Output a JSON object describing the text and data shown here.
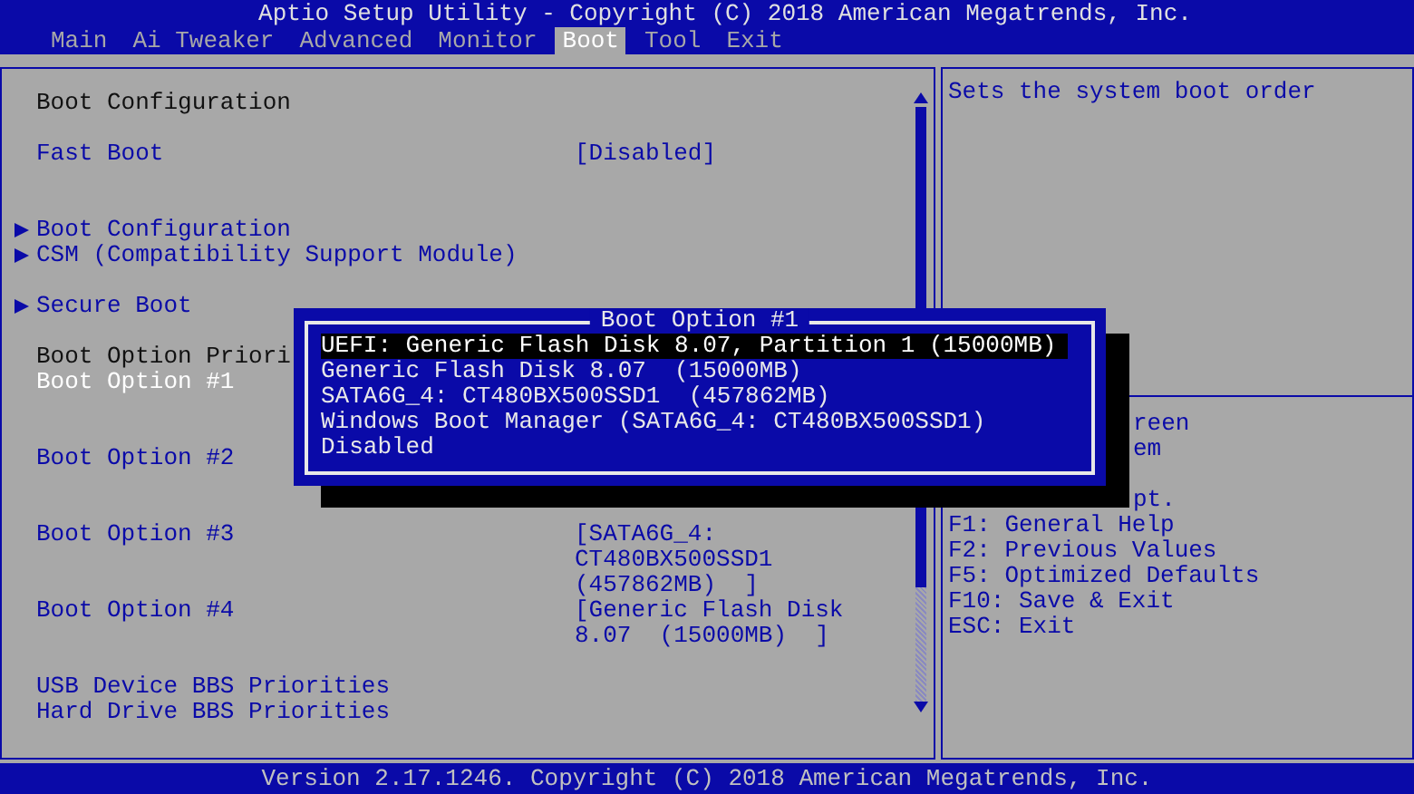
{
  "window": {
    "title": "Aptio Setup Utility - Copyright (C) 2018 American Megatrends, Inc."
  },
  "tabs": [
    {
      "label": "Main",
      "selected": false
    },
    {
      "label": "Ai Tweaker",
      "selected": false
    },
    {
      "label": "Advanced",
      "selected": false
    },
    {
      "label": "Monitor",
      "selected": false
    },
    {
      "label": "Boot",
      "selected": true
    },
    {
      "label": "Tool",
      "selected": false
    },
    {
      "label": "Exit",
      "selected": false
    }
  ],
  "rows": [
    {
      "kind": "heading",
      "label": "Boot Configuration",
      "selected": false
    },
    {
      "kind": "setting",
      "label": "Fast Boot",
      "value": [
        "[Disabled]"
      ],
      "selected": false
    },
    {
      "kind": "submenu",
      "label": "Boot Configuration",
      "selected": false
    },
    {
      "kind": "submenu",
      "label": "CSM (Compatibility Support Module)",
      "selected": false
    },
    {
      "kind": "submenu",
      "label": "Secure Boot",
      "selected": false
    },
    {
      "kind": "heading",
      "label": "Boot Option Priori",
      "selected": false
    },
    {
      "kind": "setting",
      "label": "Boot Option #1",
      "value": [],
      "selected": true
    },
    {
      "kind": "setting",
      "label": "Boot Option #2",
      "value": [],
      "selected": false
    },
    {
      "kind": "setting",
      "label": "Boot Option #3",
      "value": [
        "[SATA6G_4:",
        "CT480BX500SSD1",
        "(457862MB)  ]"
      ],
      "selected": false
    },
    {
      "kind": "setting",
      "label": "Boot Option #4",
      "value": [
        "[Generic Flash Disk",
        "8.07  (15000MB)  ]"
      ],
      "selected": false
    },
    {
      "kind": "link",
      "label": "USB Device BBS Priorities",
      "selected": false
    },
    {
      "kind": "link",
      "label": "Hard Drive BBS Priorities",
      "selected": false
    }
  ],
  "help": {
    "description": "Sets the system boot order",
    "keys": [
      {
        "kind": "partial",
        "text": "reen"
      },
      {
        "kind": "partial",
        "text": "em"
      },
      {
        "kind": "hidden"
      },
      {
        "kind": "partial",
        "text": "pt."
      },
      {
        "kind": "full",
        "text": "F1: General Help"
      },
      {
        "kind": "full",
        "text": "F2: Previous Values"
      },
      {
        "kind": "full",
        "text": "F5: Optimized Defaults"
      },
      {
        "kind": "full",
        "text": "F10: Save & Exit"
      },
      {
        "kind": "full",
        "text": "ESC: Exit"
      }
    ]
  },
  "popup": {
    "title": "Boot Option #1",
    "options": [
      {
        "label": "UEFI: Generic Flash Disk 8.07, Partition 1 (15000MB)",
        "selected": true
      },
      {
        "label": "Generic Flash Disk 8.07  (15000MB)",
        "selected": false
      },
      {
        "label": "SATA6G_4: CT480BX500SSD1  (457862MB)",
        "selected": false
      },
      {
        "label": "Windows Boot Manager (SATA6G_4: CT480BX500SSD1)",
        "selected": false
      },
      {
        "label": "Disabled",
        "selected": false
      }
    ]
  },
  "status_bar": "Version 2.17.1246. Copyright (C) 2018 American Megatrends, Inc."
}
